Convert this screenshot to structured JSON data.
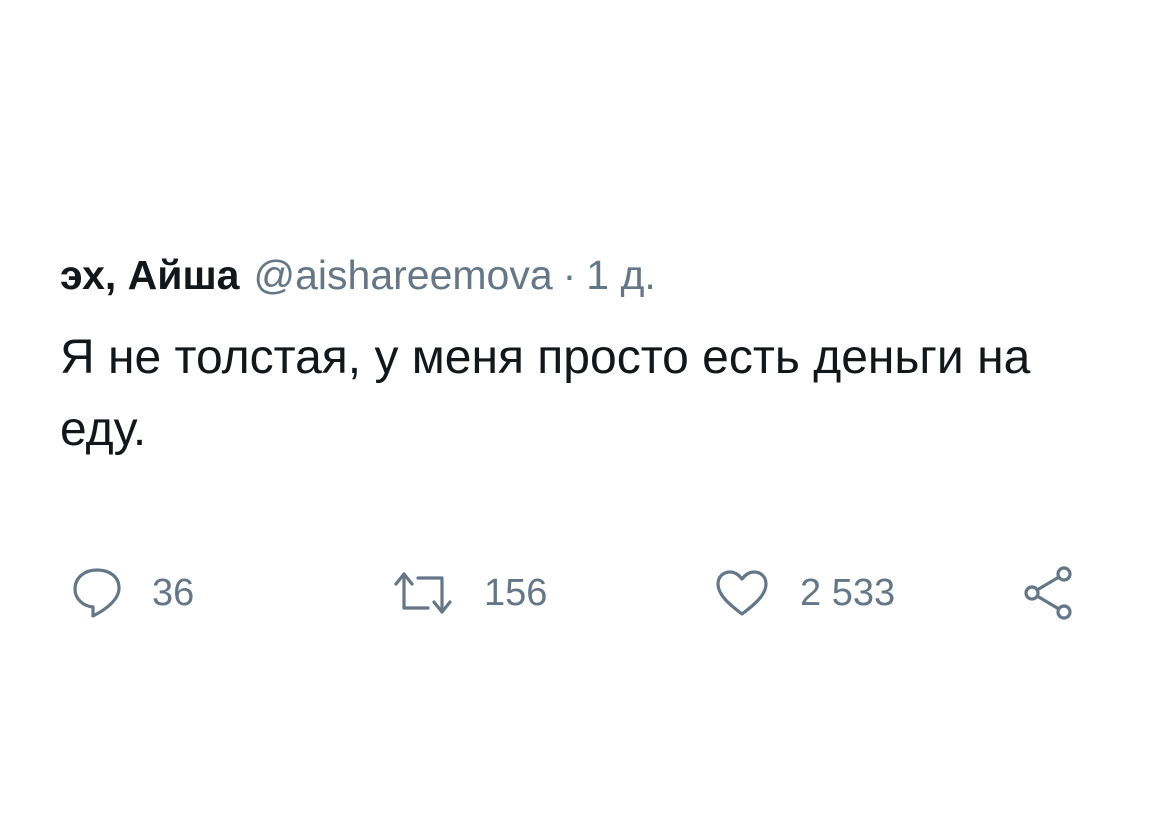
{
  "tweet": {
    "display_name": "эх, Айша",
    "handle": "@aishareemova",
    "separator": "·",
    "timestamp": "1 д.",
    "text": "Я не толстая, у меня просто есть деньги на еду."
  },
  "actions": {
    "reply": {
      "icon": "reply-icon",
      "count": "36"
    },
    "retweet": {
      "icon": "retweet-icon",
      "count": "156"
    },
    "like": {
      "icon": "heart-icon",
      "count": "2 533"
    },
    "share": {
      "icon": "share-icon"
    }
  },
  "colors": {
    "text": "#14171a",
    "secondary": "#657786",
    "background": "#ffffff"
  }
}
